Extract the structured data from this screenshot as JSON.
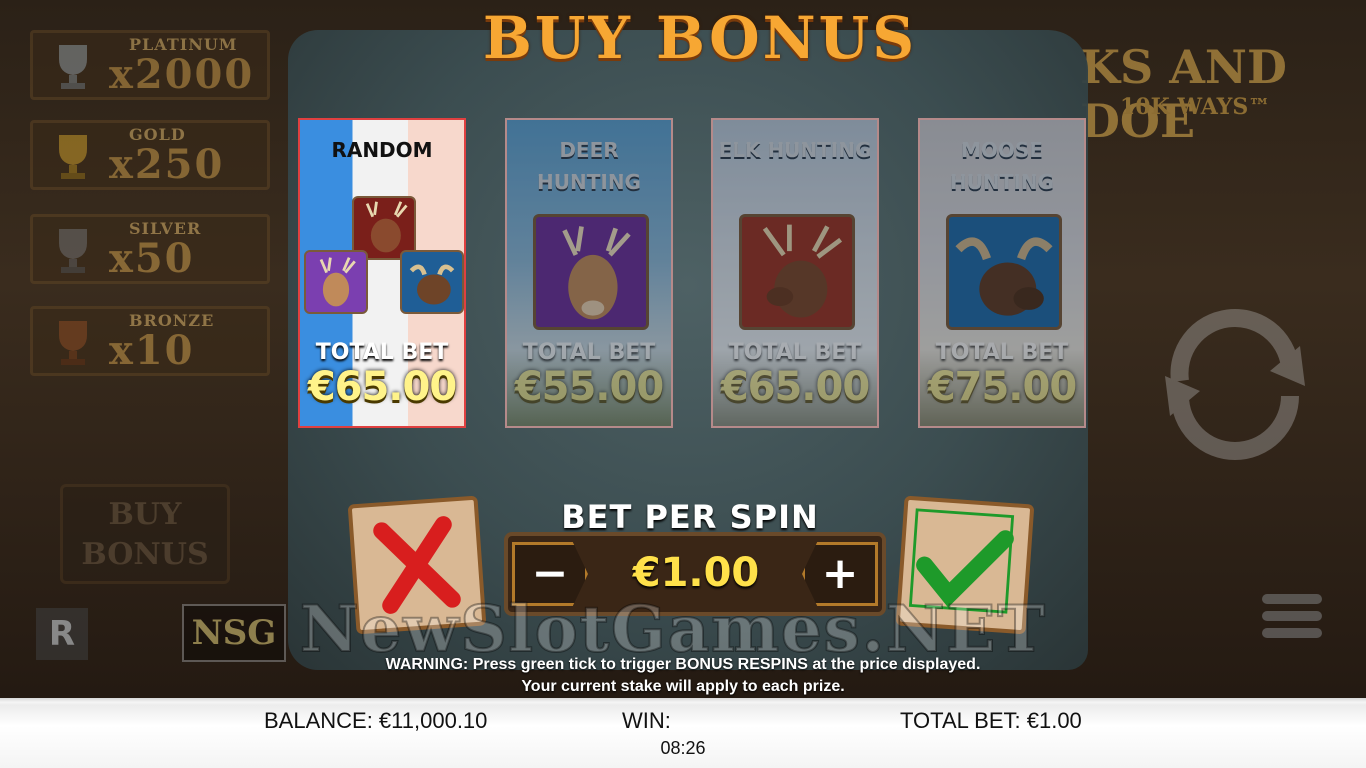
{
  "title": "BUY BONUS",
  "jackpots": [
    {
      "name": "PLATINUM",
      "multiplier": "x2000",
      "color": "#9aa3a8"
    },
    {
      "name": "GOLD",
      "multiplier": "x250",
      "color": "#d4a030"
    },
    {
      "name": "SILVER",
      "multiplier": "x50",
      "color": "#8c8c8c"
    },
    {
      "name": "BRONZE",
      "multiplier": "x10",
      "color": "#a35a28"
    }
  ],
  "game_logo": {
    "line1": "KS AND DOE",
    "line2": "10K WAYS™"
  },
  "side_buy_bonus": "BUY BONUS",
  "cards": [
    {
      "title": "RANDOM",
      "label": "TOTAL BET",
      "price": "€65.00",
      "selected": true
    },
    {
      "title": "DEER HUNTING",
      "label": "TOTAL BET",
      "price": "€55.00",
      "selected": false,
      "accent": "#7a3fa8"
    },
    {
      "title": "ELK HUNTING",
      "label": "TOTAL BET",
      "price": "€65.00",
      "selected": false,
      "accent": "#b8402e"
    },
    {
      "title": "MOOSE HUNTING",
      "label": "TOTAL BET",
      "price": "€75.00",
      "selected": false,
      "accent": "#2e7fb8"
    }
  ],
  "bet": {
    "title": "BET PER SPIN",
    "value": "€1.00",
    "minus": "−",
    "plus": "+"
  },
  "watermark": {
    "text": "NewSlotGames.NET",
    "logo": "NSG"
  },
  "warning": {
    "line1": "WARNING: Press green tick to trigger BONUS RESPINS at the price displayed.",
    "line2": "Your current stake will apply to each prize."
  },
  "brand_badge": "R",
  "footer": {
    "balance": "BALANCE: €11,000.10",
    "win": "WIN:",
    "total_bet": "TOTAL BET: €1.00",
    "clock": "08:26"
  },
  "icons": [
    "trophy-icon",
    "deer-icon",
    "elk-icon",
    "moose-icon",
    "cross-icon",
    "check-icon",
    "minus-icon",
    "plus-icon",
    "menu-icon",
    "autospin-icon"
  ],
  "colors": {
    "title": "#f7a733",
    "price": "#fff38a",
    "bet_value": "#ffe14a",
    "confirm": "#1e9a2a",
    "cancel": "#d81e1e"
  }
}
